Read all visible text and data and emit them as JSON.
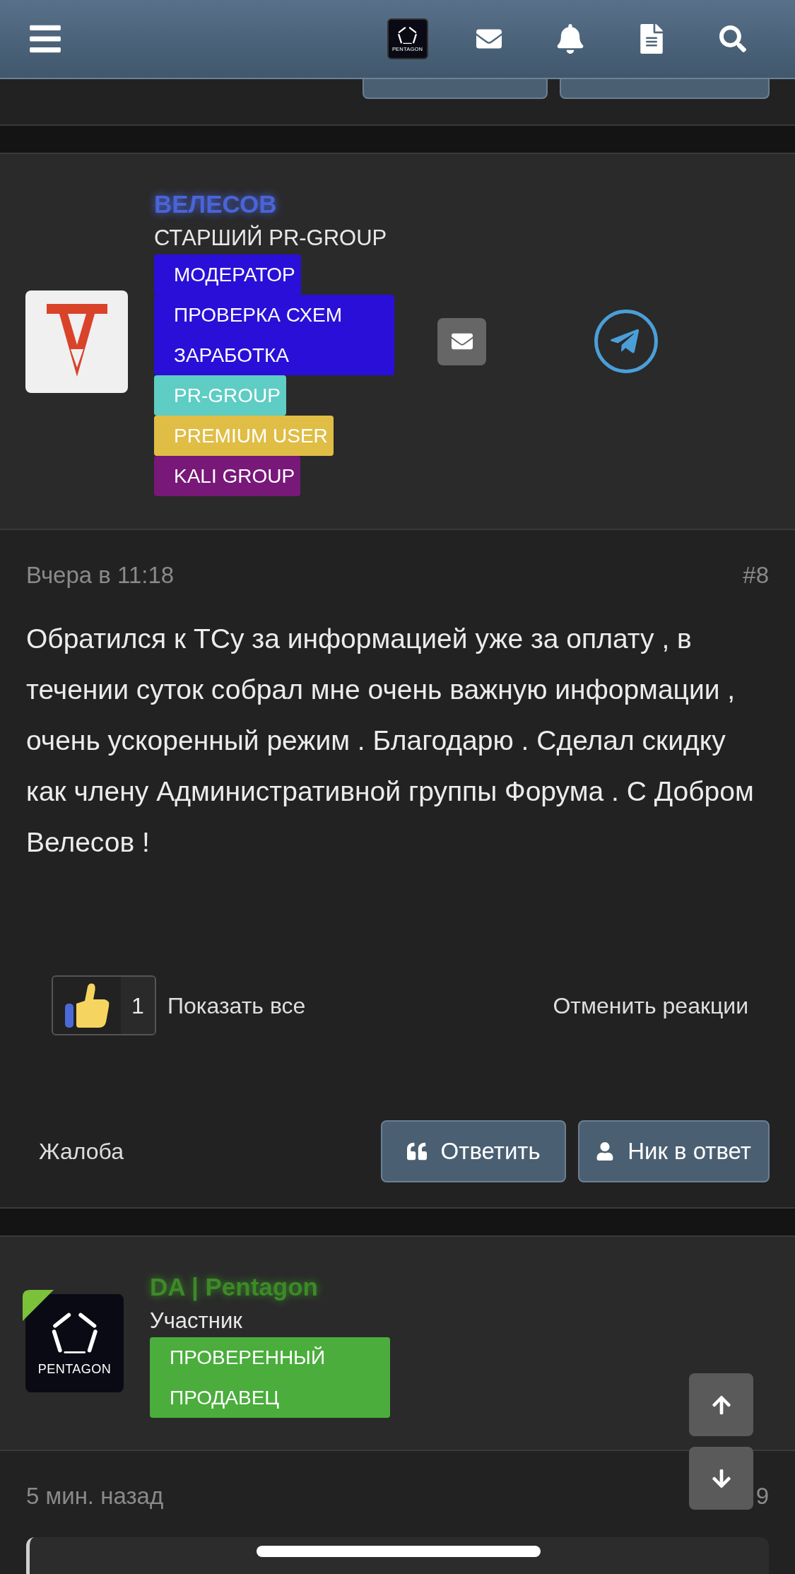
{
  "header": {
    "logo_text": "PENTAGON"
  },
  "posts": [
    {
      "author": {
        "name": "ВЕЛЕСОВ",
        "color": "#4a64d8",
        "title": "СТАРШИЙ PR-GROUP",
        "online": false,
        "avatar": {
          "kind": "v-logo"
        }
      },
      "banners": [
        {
          "text": "МОДЕРАТОР",
          "color": "#2a0fd8"
        },
        {
          "text": "ПРОВЕРКА СХЕМ ЗАРАБОТКА",
          "color": "#2a0fd8"
        },
        {
          "text": "PR-GROUP",
          "color": "#5ecdc4"
        },
        {
          "text": "PREMIUM USER",
          "color": "#e0bd45"
        },
        {
          "text": "KALI GROUP",
          "color": "#781878"
        }
      ],
      "contact_buttons": true,
      "date": "Вчера в 11:18",
      "number": "#8",
      "message": "Обратился к ТСу за информацией уже за оплату , в течении суток собрал мне очень важную информации , очень ускоренный режим . Благодарю . Сделал скидку как члену Административной группы Форума . С Добром Велесов !",
      "reactions": {
        "count": "1",
        "show_all": "Показать все",
        "undo": "Отменить реакции"
      },
      "actions": {
        "report": "Жалоба",
        "buttons": [
          {
            "label": "Ответить",
            "kind": "quote"
          },
          {
            "label": "Ник в ответ",
            "kind": "mention"
          }
        ]
      }
    },
    {
      "author": {
        "name": "DA | Pentagon",
        "color": "#3c8a28",
        "title": "Участник",
        "online": true,
        "avatar": {
          "kind": "pentagon-logo",
          "text": "PENTAGON"
        }
      },
      "banners": [
        {
          "text": "ПРОВЕРЕННЫЙ ПРОДАВЕЦ",
          "color": "#4aad3c"
        }
      ],
      "date": "5 мин. назад",
      "number": "9"
    }
  ]
}
